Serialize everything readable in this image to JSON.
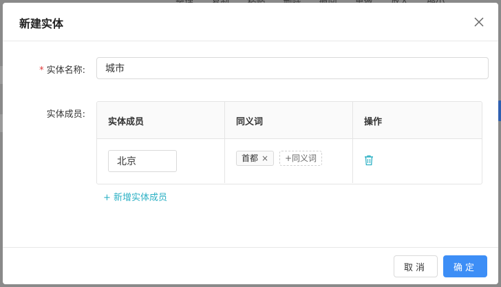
{
  "background": {
    "toolbar_items": [
      "整理",
      "复制",
      "粘贴",
      "删除",
      "撤回",
      "重做",
      "放大",
      "缩小"
    ]
  },
  "modal": {
    "title": "新建实体",
    "close_icon": "close-icon"
  },
  "form": {
    "name_label": "实体名称:",
    "required_mark": "*",
    "name_value": "城市",
    "members_label": "实体成员:"
  },
  "table": {
    "headers": [
      "实体成员",
      "同义词",
      "操作"
    ],
    "rows": [
      {
        "member": "北京",
        "synonyms": [
          "首都"
        ],
        "add_synonym_label": "+同义词",
        "delete_icon": "trash-icon"
      }
    ]
  },
  "add_member_label": "+ 新增实体成员",
  "footer": {
    "cancel_label": "取消",
    "ok_label": "确定"
  },
  "colors": {
    "accent": "#3d8ef6",
    "link": "#2bb0c4",
    "required": "#e03a3a"
  }
}
